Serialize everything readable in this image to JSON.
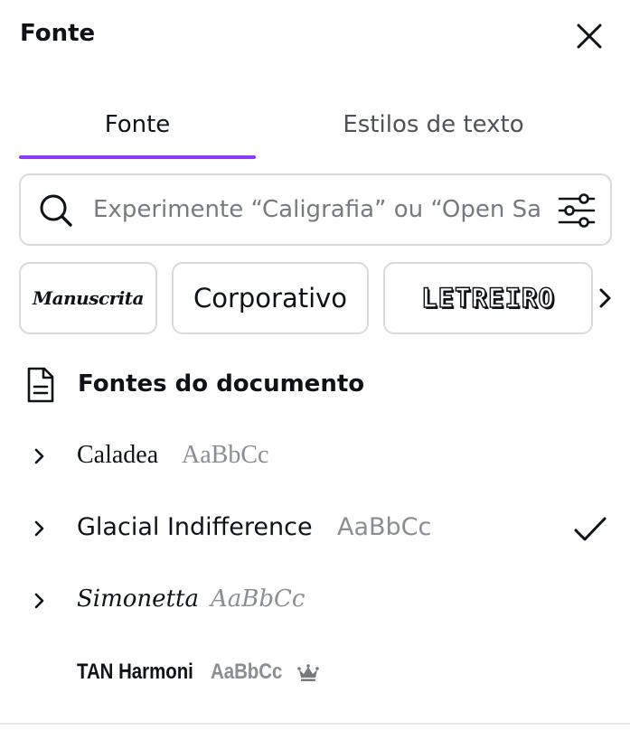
{
  "panel": {
    "title": "Fonte"
  },
  "tabs": [
    {
      "label": "Fonte",
      "active": true
    },
    {
      "label": "Estilos de texto",
      "active": false
    }
  ],
  "search": {
    "placeholder": "Experimente “Caligrafia” ou “Open Sa",
    "value": ""
  },
  "categories": [
    {
      "label": "Manuscrita"
    },
    {
      "label": "Corporativo"
    },
    {
      "label": "LETREIRO"
    }
  ],
  "document_fonts": {
    "title": "Fontes do documento",
    "fonts": [
      {
        "name": "Caladea",
        "sample": "AaBbCc",
        "selected": false,
        "premium": false
      },
      {
        "name": "Glacial Indifference",
        "sample": "AaBbCc",
        "selected": true,
        "premium": false
      },
      {
        "name": "Simonetta",
        "sample": "AaBbCc",
        "selected": false,
        "premium": false
      },
      {
        "name": "TAN Harmoni",
        "sample": "AaBbCc",
        "selected": false,
        "premium": true
      }
    ]
  },
  "colors": {
    "accent": "#8b3dff",
    "text": "#0e1318",
    "muted": "#8a8d91",
    "border": "#d8dadd"
  },
  "icons": [
    "close-icon",
    "search-icon",
    "filter-icon",
    "chevron-right-icon",
    "document-icon",
    "check-icon",
    "crown-icon"
  ]
}
